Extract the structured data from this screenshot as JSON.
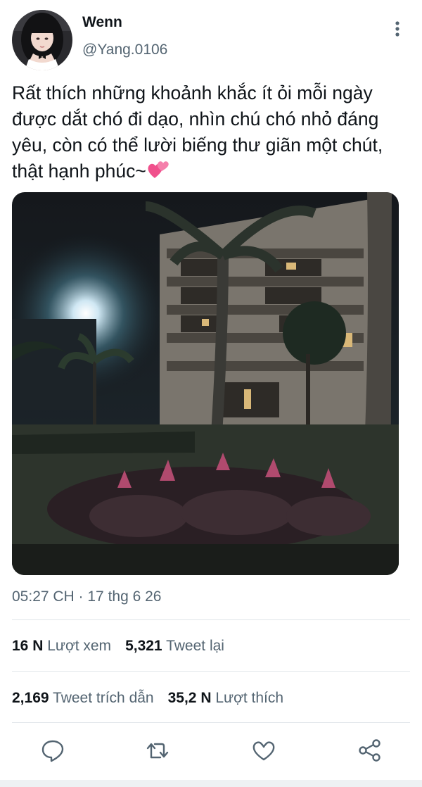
{
  "tweet": {
    "author_name": "Wenn",
    "author_handle": "@Yang.0106",
    "text": "Rất thích những khoảnh khắc ít ỏi mỗi ngày được dắt chó đi dạo, nhìn chú chó nhỏ đáng yêu, còn có thể lười biếng thư giãn một chút, thật hạnh phúc~",
    "emoji_icon": "two-hearts-icon",
    "timestamp": "05:27 CH · 17 thg 6 26"
  },
  "stats": {
    "views_count": "16 N",
    "views_label": "Lượt xem",
    "retweets_count": "5,321",
    "retweets_label": "Tweet lại",
    "quotes_count": "2,169",
    "quotes_label": "Tweet trích dẫn",
    "likes_count": "35,2 N",
    "likes_label": "Lượt thích"
  },
  "actions": [
    "reply-icon",
    "retweet-icon",
    "like-icon",
    "share-icon"
  ],
  "colors": {
    "text": "#0f1419",
    "secondary": "#536471",
    "divider": "#e1e6ea",
    "accent_emoji": "#f0508c"
  }
}
